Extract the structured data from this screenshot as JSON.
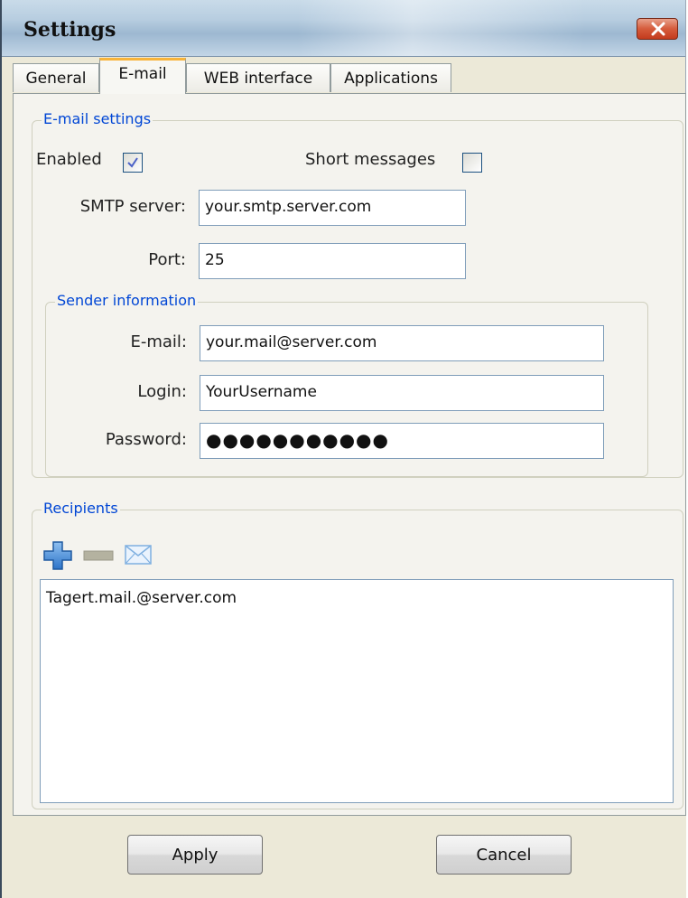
{
  "window": {
    "title": "Settings"
  },
  "tabs": [
    {
      "label": "General",
      "active": false
    },
    {
      "label": "E-mail",
      "active": true
    },
    {
      "label": "WEB interface",
      "active": false
    },
    {
      "label": "Applications",
      "active": false
    }
  ],
  "email_settings": {
    "group_title": "E-mail settings",
    "enabled_label": "Enabled",
    "enabled_checked": true,
    "short_messages_label": "Short messages",
    "short_messages_checked": false,
    "smtp_label": "SMTP server:",
    "smtp_value": "your.smtp.server.com",
    "port_label": "Port:",
    "port_value": "25"
  },
  "sender": {
    "group_title": "Sender information",
    "email_label": "E-mail:",
    "email_value": "your.mail@server.com",
    "login_label": "Login:",
    "login_value": "YourUsername",
    "password_label": "Password:",
    "password_value": "●●●●●●●●●●●"
  },
  "recipients": {
    "group_title": "Recipients",
    "items": [
      "Tagert.mail.@server.com"
    ]
  },
  "footer": {
    "apply_label": "Apply",
    "cancel_label": "Cancel"
  },
  "colors": {
    "accent": "#0046d5",
    "tab_highlight": "#f8b43a",
    "close_button": "#c43b1d"
  }
}
